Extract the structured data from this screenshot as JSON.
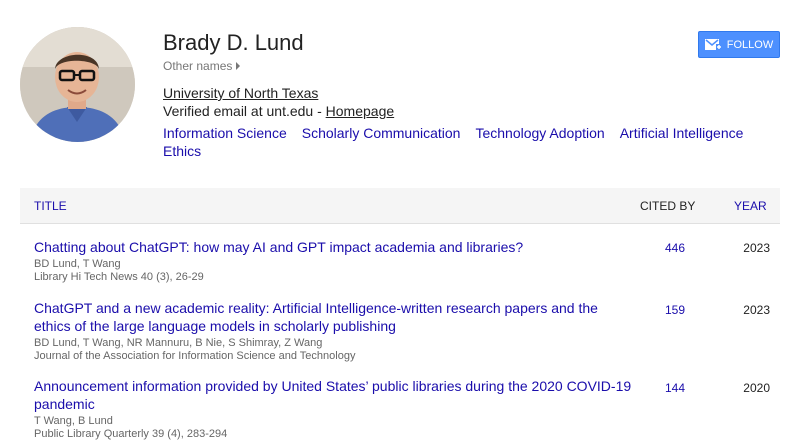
{
  "profile": {
    "name": "Brady D. Lund",
    "other_names": "Other names",
    "affiliation": "University of North Texas",
    "email_text": "Verified email at unt.edu - ",
    "homepage": "Homepage",
    "interests": [
      "Information Science",
      "Scholarly Communication",
      "Technology Adoption",
      "Artificial Intelligence",
      "Ethics"
    ]
  },
  "follow": {
    "label": "FOLLOW",
    "icon": "envelope-plus-icon",
    "color": "#4d90fe"
  },
  "table": {
    "headers": {
      "title": "TITLE",
      "cited_by": "CITED BY",
      "year": "YEAR"
    },
    "rows": [
      {
        "title": "Chatting about ChatGPT: how may AI and GPT impact academia and libraries?",
        "authors": "BD Lund, T Wang",
        "venue": "Library Hi Tech News 40 (3), 26-29",
        "cited": "446",
        "year": "2023"
      },
      {
        "title": "ChatGPT and a new academic reality: Artificial Intelligence-written research papers and the ethics of the large language models in scholarly publishing",
        "authors": "BD Lund, T Wang, NR Mannuru, B Nie, S Shimray, Z Wang",
        "venue": "Journal of the Association for Information Science and Technology",
        "cited": "159",
        "year": "2023"
      },
      {
        "title": "Announcement information provided by United States’ public libraries during the 2020 COVID-19 pandemic",
        "authors": "T Wang, B Lund",
        "venue": "Public Library Quarterly 39 (4), 283-294",
        "cited": "144",
        "year": "2020"
      }
    ]
  },
  "colors": {
    "link": "#1a0dab",
    "header_bg": "#f5f5f5",
    "button": "#4d90fe"
  }
}
